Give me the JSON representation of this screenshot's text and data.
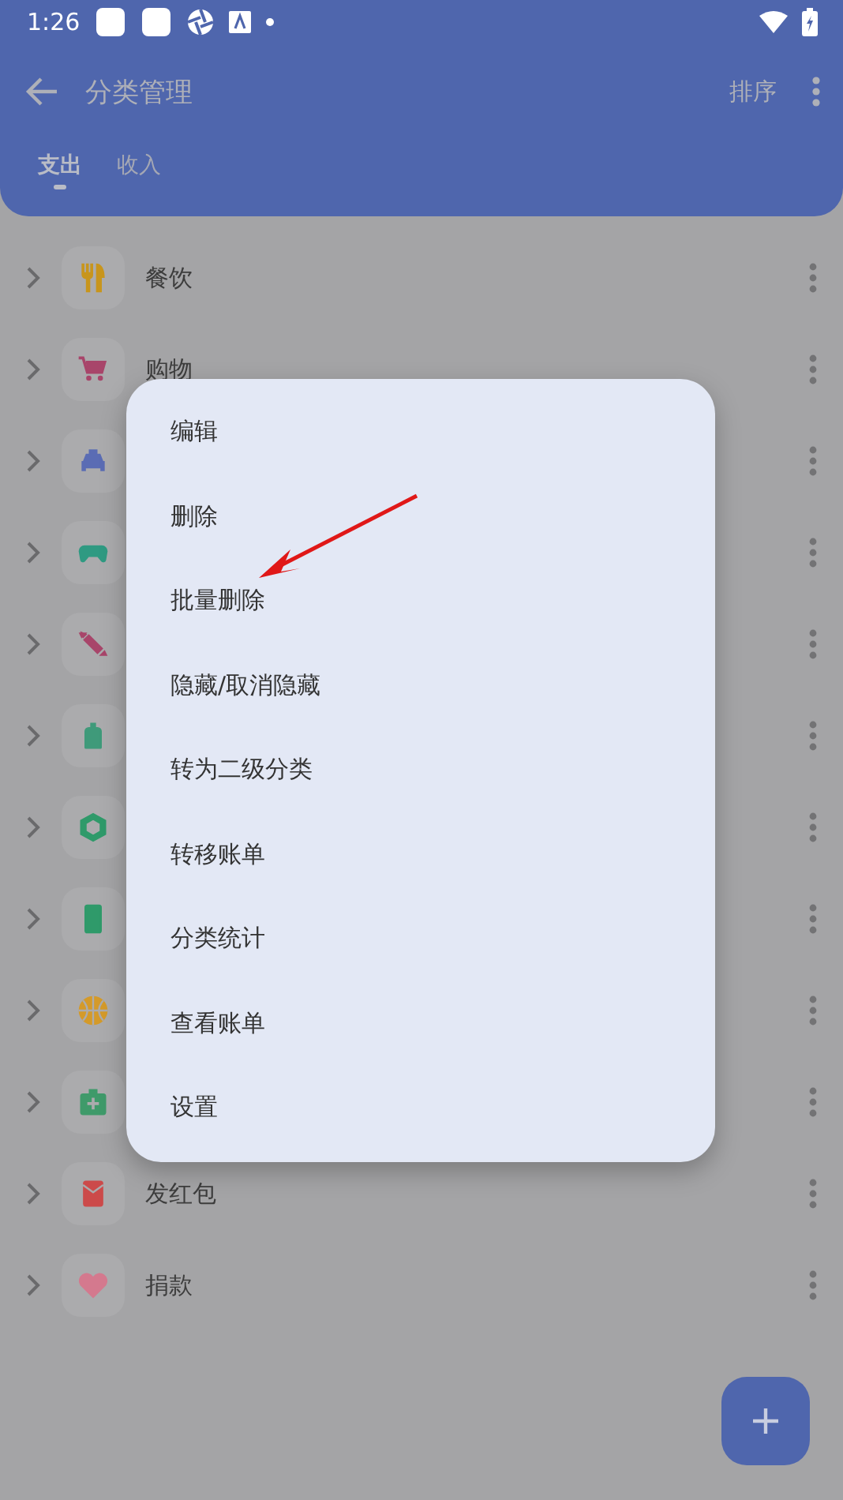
{
  "status_bar": {
    "time": "1:26"
  },
  "app_bar": {
    "title": "分类管理",
    "action": "排序"
  },
  "tabs": [
    {
      "label": "支出",
      "selected": true
    },
    {
      "label": "收入",
      "selected": false
    }
  ],
  "categories": [
    {
      "label": "餐饮",
      "color": "#c8951c"
    },
    {
      "label": "购物",
      "color": "#a8456a"
    },
    {
      "color": "#5a6cb4"
    },
    {
      "color": "#2f9a82"
    },
    {
      "color": "#a8456a"
    },
    {
      "color": "#3f9a7a"
    },
    {
      "color": "#2f9a6a"
    },
    {
      "color": "#2f9a6a"
    },
    {
      "color": "#d49a2a"
    },
    {
      "color": "#3f9a6a"
    },
    {
      "label": "发红包",
      "color": "#cc4a4a"
    },
    {
      "label": "捐款",
      "color": "#d4798e"
    }
  ],
  "context_menu": {
    "items": [
      "编辑",
      "删除",
      "批量删除",
      "隐藏/取消隐藏",
      "转为二级分类",
      "转移账单",
      "分类统计",
      "查看账单",
      "设置"
    ]
  }
}
